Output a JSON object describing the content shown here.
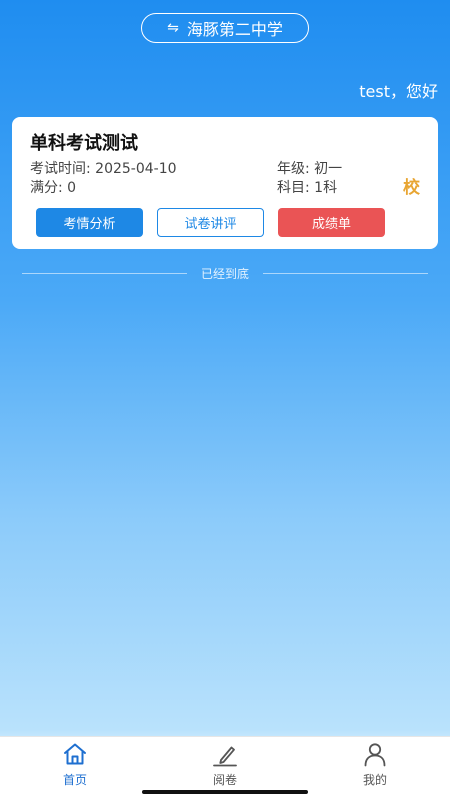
{
  "header": {
    "school_switch_icon": "swap-arrows-icon",
    "school_name": "海豚第二中学",
    "greeting": "test，您好"
  },
  "exam_card": {
    "title": "单科考试测试",
    "exam_time": "考试时间: 2025-04-10",
    "full_score": "满分: 0",
    "grade": "年级: 初一",
    "subjects": "科目: 1科",
    "badge": "校",
    "badge_color": "#e8a532",
    "buttons": {
      "analysis": "考情分析",
      "review": "试卷讲评",
      "report": "成绩单"
    }
  },
  "end_of_list": "已经到底",
  "tabbar": {
    "active_color": "#1e6fd0",
    "items": [
      {
        "label": "首页",
        "icon": "home-icon",
        "active": true
      },
      {
        "label": "阅卷",
        "icon": "pencil-icon",
        "active": false
      },
      {
        "label": "我的",
        "icon": "person-icon",
        "active": false
      }
    ]
  }
}
